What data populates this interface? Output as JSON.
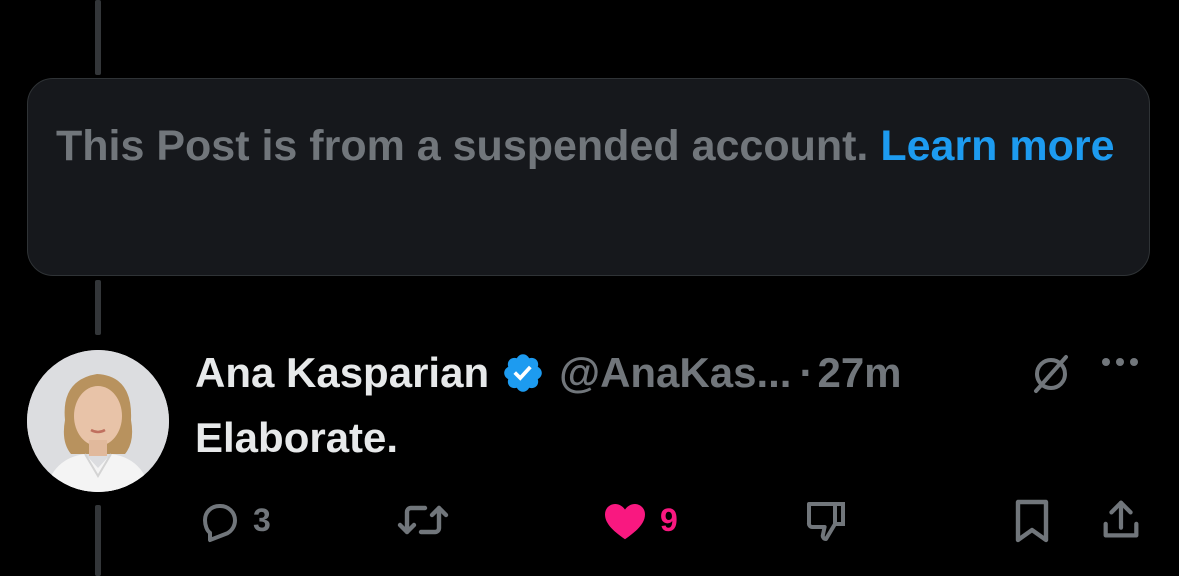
{
  "suspended_notice": {
    "text": "This Post is from a suspended account.",
    "link_label": "Learn more"
  },
  "tweet": {
    "author_name": "Ana Kasparian",
    "handle": "@AnaKas...",
    "separator": "·",
    "time": "27m",
    "text": "Elaborate.",
    "verified": true,
    "actions": {
      "reply_count": "3",
      "like_count": "9",
      "liked": true
    }
  },
  "colors": {
    "background": "#000000",
    "box_background": "#16181c",
    "primary_text": "#e7e9ea",
    "secondary_text": "#71767b",
    "link": "#1d9bf0",
    "like": "#f91880"
  },
  "icons": [
    "reply-icon",
    "retweet-icon",
    "heart-icon",
    "dislike-icon",
    "bookmark-icon",
    "share-icon",
    "grok-icon",
    "more-icon",
    "verified-badge-icon"
  ]
}
